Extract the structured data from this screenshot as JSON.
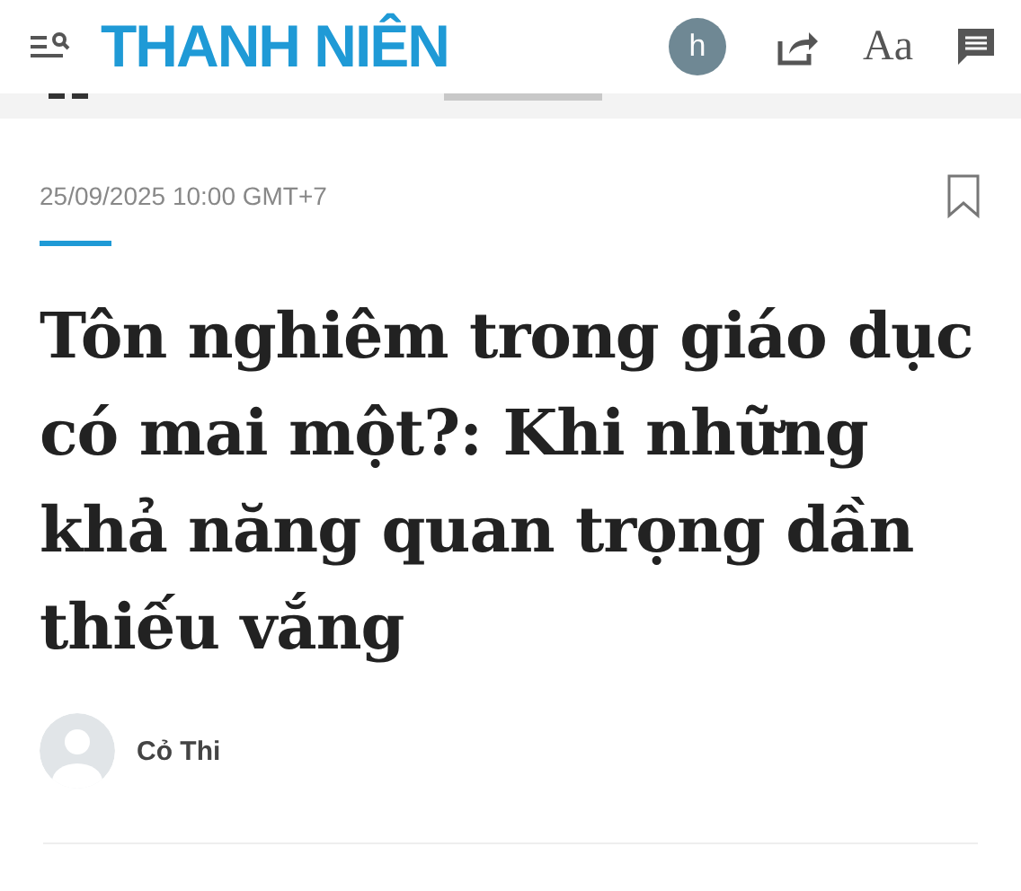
{
  "header": {
    "logo": "THANH NIÊN",
    "avatar_letter": "h",
    "font_button": "Aa"
  },
  "article": {
    "date": "25/09/2025 10:00 GMT+7",
    "title": "Tôn nghiêm trong giáo dục có mai một?: Khi những khả năng quan trọng dần thiếu vắng",
    "author": "Cỏ Thi"
  }
}
